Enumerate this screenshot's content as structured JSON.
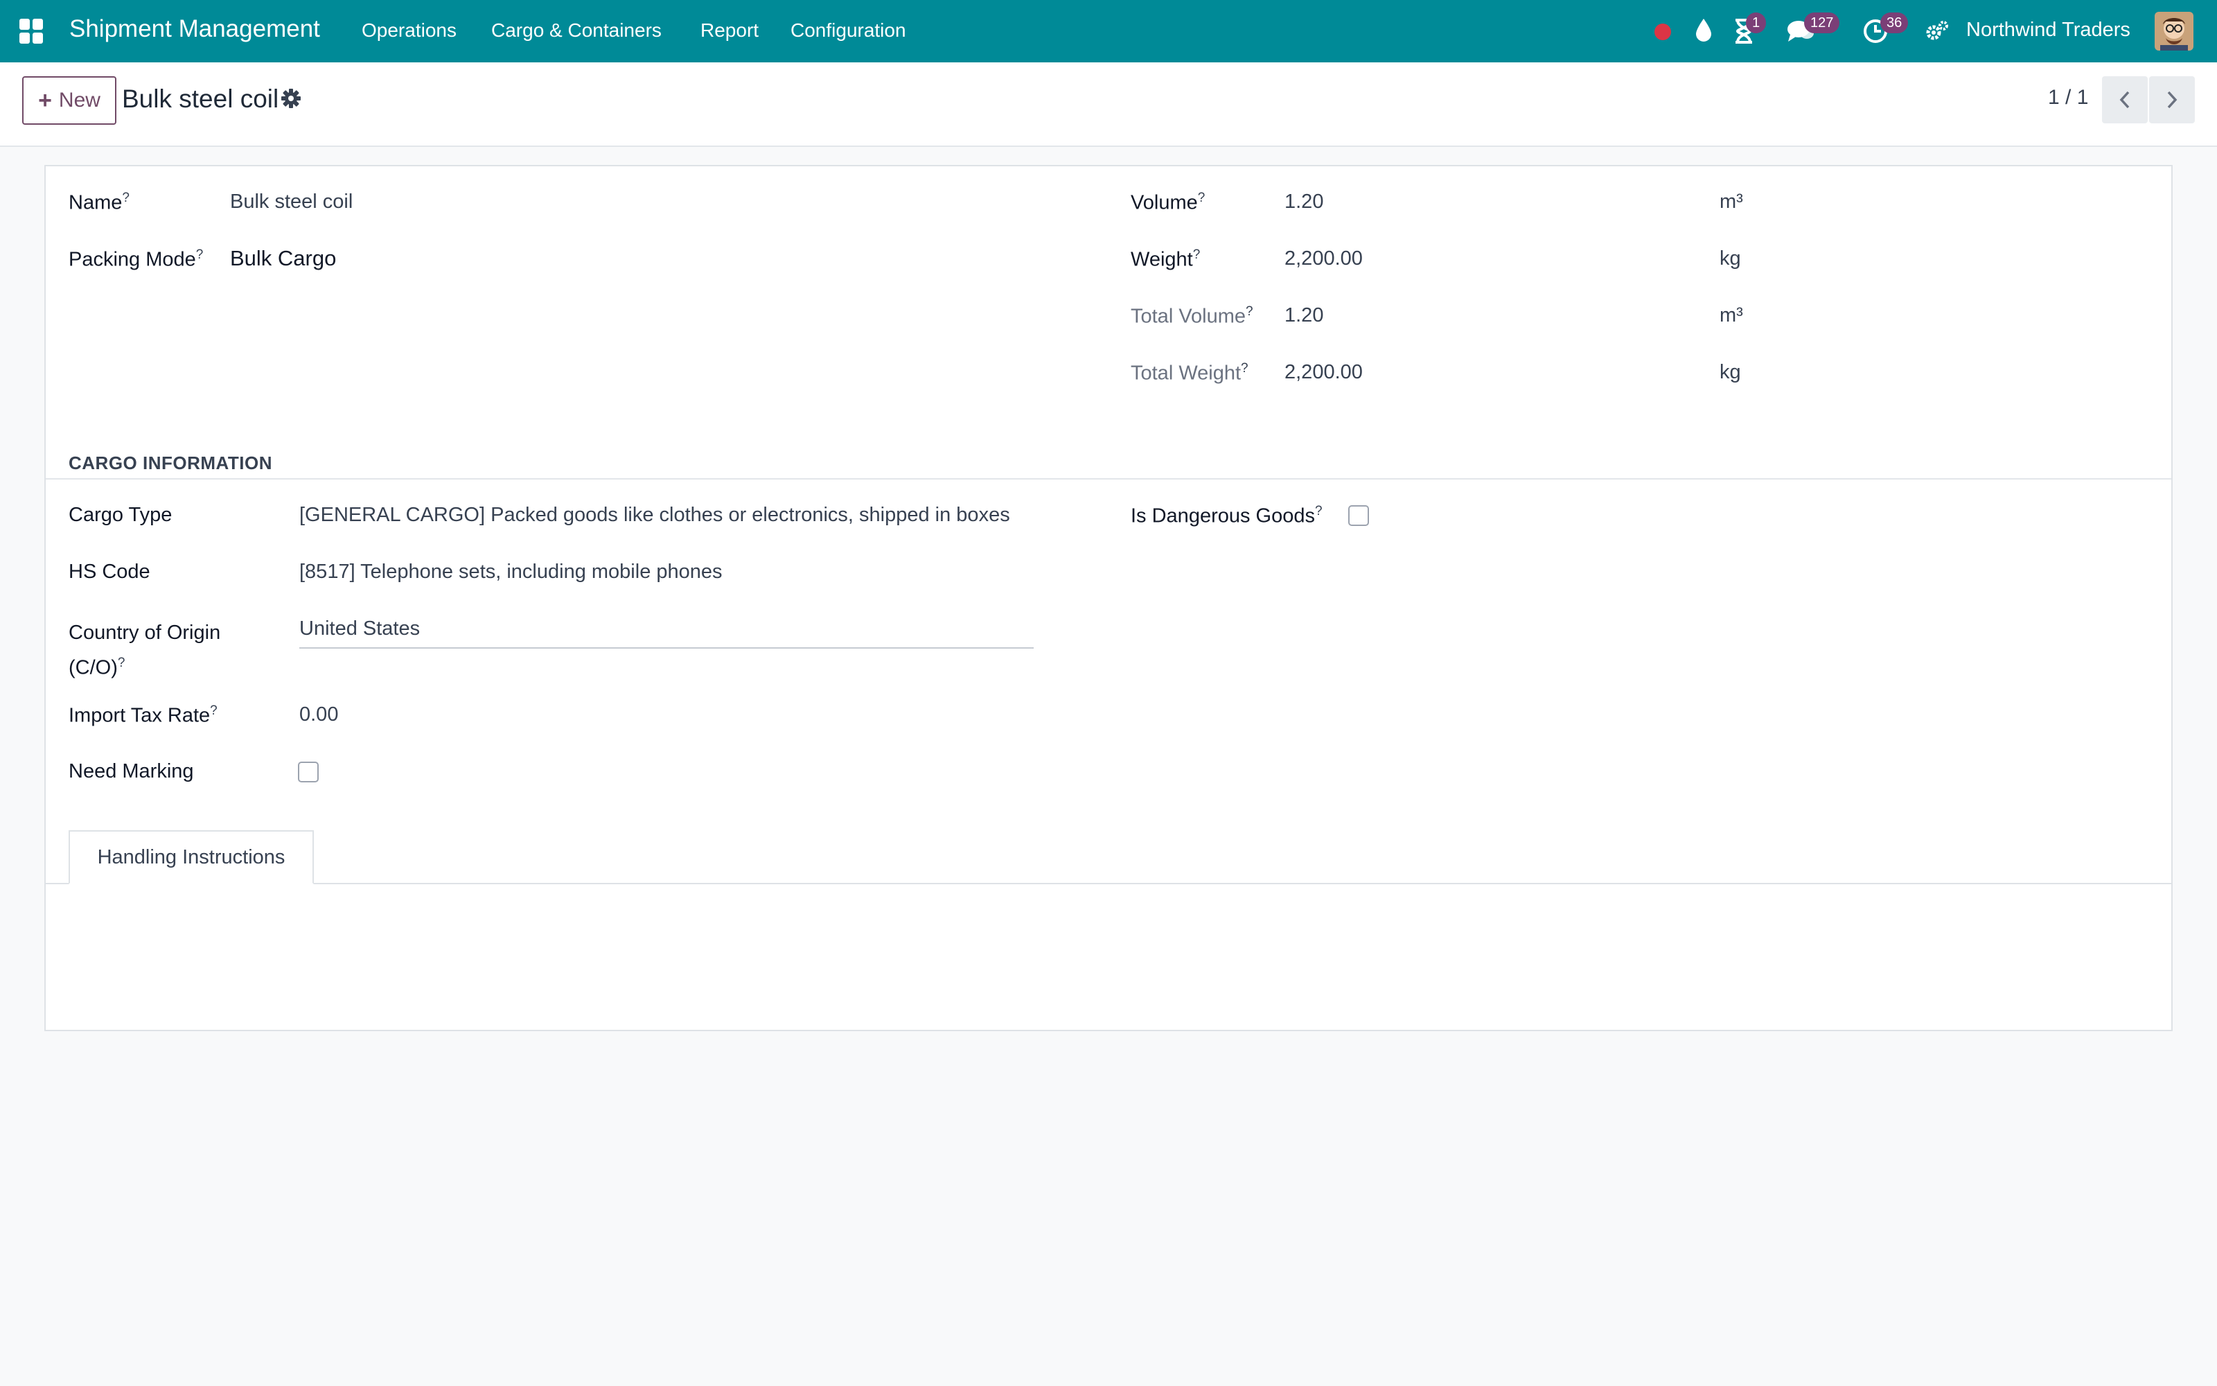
{
  "navbar": {
    "app_name": "Shipment Management",
    "menus": [
      "Operations",
      "Cargo & Containers",
      "Report",
      "Configuration"
    ],
    "activity_badge": "1",
    "messages_badge": "127",
    "clock_badge": "36",
    "company": "Northwind Traders",
    "accent": "#008a97"
  },
  "control": {
    "new_label": "New",
    "record_title": "Bulk steel coil",
    "pager": "1 / 1"
  },
  "form": {
    "name_label": "Name",
    "name_value": "Bulk steel coil",
    "packing_mode_label": "Packing Mode",
    "packing_mode_value": "Bulk Cargo",
    "volume_label": "Volume",
    "volume_value": "1.20",
    "volume_unit": "m³",
    "weight_label": "Weight",
    "weight_value": "2,200.00",
    "weight_unit": "kg",
    "total_volume_label": "Total Volume",
    "total_volume_value": "1.20",
    "total_volume_unit": "m³",
    "total_weight_label": "Total Weight",
    "total_weight_value": "2,200.00",
    "total_weight_unit": "kg",
    "help_mark": "?",
    "section_cargo": "CARGO INFORMATION",
    "cargo_type_label": "Cargo Type",
    "cargo_type_value": "[GENERAL CARGO] Packed goods like clothes or electronics, shipped in boxes",
    "hs_code_label": "HS Code",
    "hs_code_value": "[8517] Telephone sets, including mobile phones",
    "country_label_1": "Country of Origin",
    "country_label_2": "(C/O)",
    "country_value": "United States",
    "import_tax_label": "Import Tax Rate",
    "import_tax_value": "0.00",
    "need_marking_label": "Need Marking",
    "dangerous_label": "Is Dangerous Goods",
    "tab_handling": "Handling Instructions"
  }
}
